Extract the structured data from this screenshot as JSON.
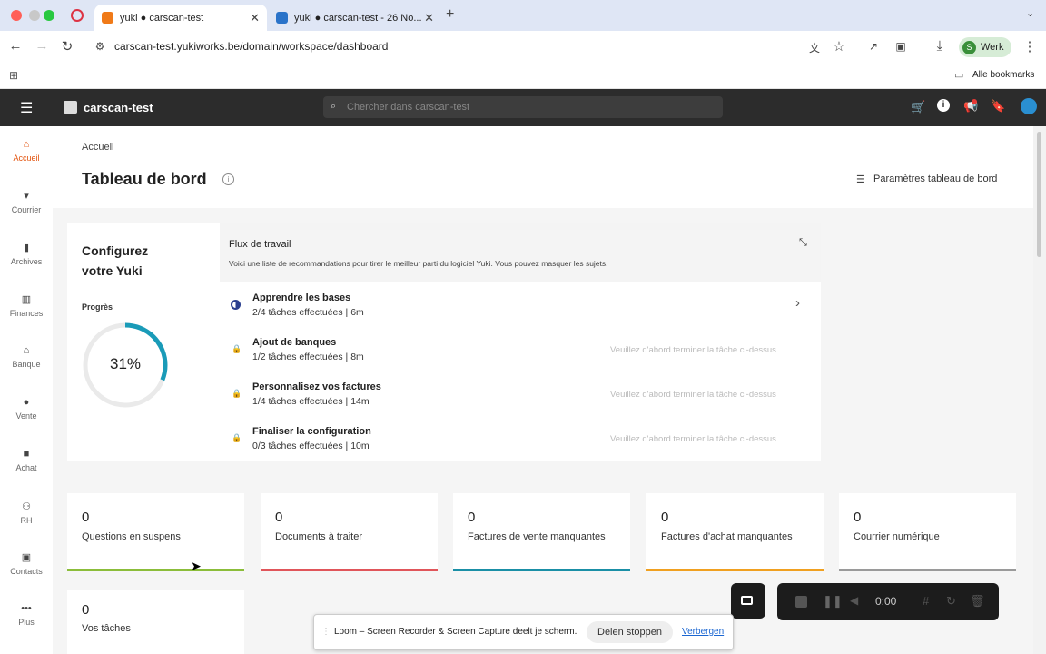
{
  "browser": {
    "tabs": [
      {
        "title": "yuki ● carscan-test",
        "active": true
      },
      {
        "title": "yuki ● carscan-test - 26 No...",
        "active": false
      }
    ],
    "url": "carscan-test.yukiworks.be/domain/workspace/dashboard",
    "profile_label": "Werk",
    "profile_initial": "S",
    "bookmarks_label": "Alle bookmarks"
  },
  "app": {
    "workspace_name": "carscan-test",
    "search_placeholder": "Chercher dans carscan-test"
  },
  "sidebar": {
    "items": [
      {
        "label": "Accueil",
        "icon": "home-icon",
        "active": true
      },
      {
        "label": "Courrier",
        "icon": "inbox-icon"
      },
      {
        "label": "Archives",
        "icon": "archive-icon"
      },
      {
        "label": "Finances",
        "icon": "bar-chart-icon"
      },
      {
        "label": "Banque",
        "icon": "bank-icon"
      },
      {
        "label": "Vente",
        "icon": "sales-icon"
      },
      {
        "label": "Achat",
        "icon": "purchase-icon"
      },
      {
        "label": "RH",
        "icon": "people-icon"
      },
      {
        "label": "Contacts",
        "icon": "contacts-icon"
      },
      {
        "label": "Plus",
        "icon": "more-icon"
      }
    ]
  },
  "page": {
    "breadcrumb": "Accueil",
    "title": "Tableau de bord",
    "settings_label": "Paramètres tableau de bord"
  },
  "setup": {
    "title_line1": "Configurez",
    "title_line2": "votre Yuki",
    "progress_label": "Progrès",
    "progress_percent": 31,
    "progress_text": "31%"
  },
  "workflow": {
    "title": "Flux de travail",
    "description": "Voici une liste de recommandations pour tirer le meilleur parti du logiciel Yuki. Vous pouvez masquer les sujets.",
    "tasks": [
      {
        "title": "Apprendre les bases",
        "meta": "2/4 tâches effectuées | 6m",
        "status": "",
        "locked": false
      },
      {
        "title": "Ajout de banques",
        "meta": "1/2 tâches effectuées | 8m",
        "status": "Veuillez d'abord terminer la tâche ci-dessus",
        "locked": true
      },
      {
        "title": "Personnalisez vos factures",
        "meta": "1/4 tâches effectuées | 14m",
        "status": "Veuillez d'abord terminer la tâche ci-dessus",
        "locked": true
      },
      {
        "title": "Finaliser la configuration",
        "meta": "0/3 tâches effectuées | 10m",
        "status": "Veuillez d'abord terminer la tâche ci-dessus",
        "locked": true
      }
    ]
  },
  "stats": [
    {
      "value": "0",
      "label": "Questions en suspens",
      "color": "#8bbd3a"
    },
    {
      "value": "0",
      "label": "Documents à traiter",
      "color": "#e0555a"
    },
    {
      "value": "0",
      "label": "Factures de vente manquantes",
      "color": "#1a8fa6"
    },
    {
      "value": "0",
      "label": "Factures d'achat manquantes",
      "color": "#f0a020"
    },
    {
      "value": "0",
      "label": "Courrier numérique",
      "color": "#9a9a9a"
    },
    {
      "value": "0",
      "label": "Vos tâches",
      "color": "#cccccc"
    }
  ],
  "recorder": {
    "timer": "0:00"
  },
  "share_bar": {
    "message": "Loom – Screen Recorder & Screen Capture deelt je scherm.",
    "stop_label": "Delen stoppen",
    "hide_label": "Verbergen"
  },
  "colors": {
    "accent_teal": "#1a9bb8",
    "header_dark": "#2c2c2c",
    "active_red": "#e3530d"
  }
}
